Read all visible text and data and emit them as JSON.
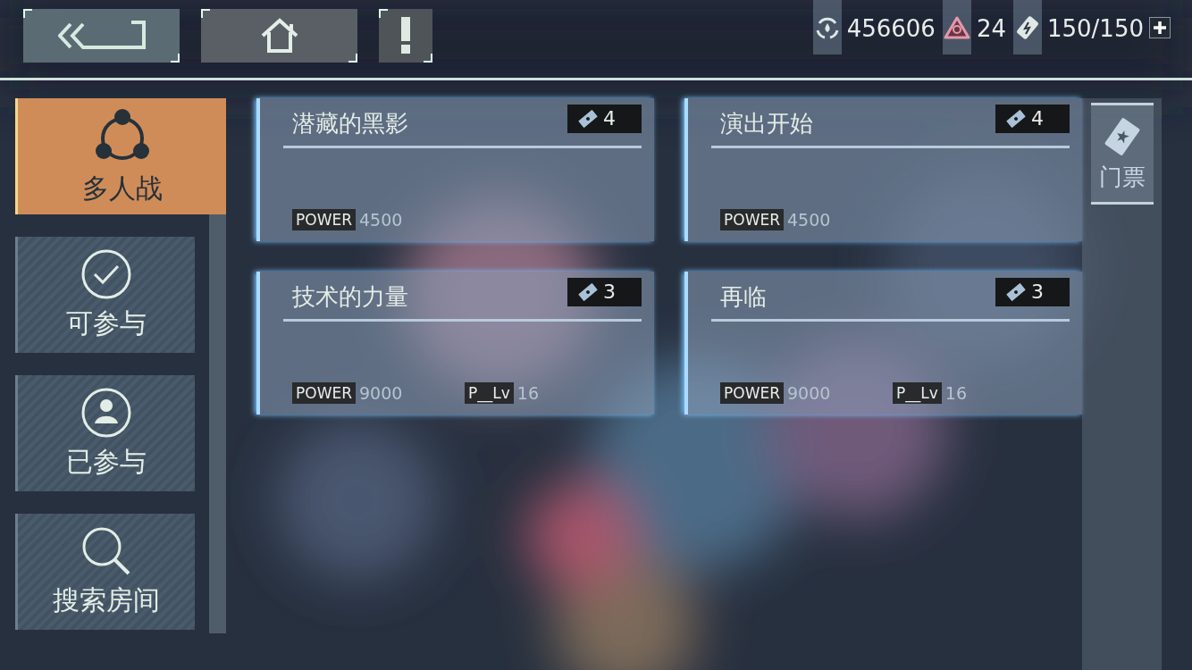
{
  "resources": [
    {
      "kind": "coin",
      "value": "456606",
      "can_add": false
    },
    {
      "kind": "crystal",
      "value": "24",
      "can_add": false
    },
    {
      "kind": "stamina",
      "value": "150/150",
      "can_add": true
    }
  ],
  "sidebar": {
    "items": [
      {
        "kind": "multiplayer",
        "label": "多人战",
        "selected": true
      },
      {
        "kind": "joinable",
        "label": "可参与",
        "selected": false
      },
      {
        "kind": "joined",
        "label": "已参与",
        "selected": false
      },
      {
        "kind": "search",
        "label": "搜索房间",
        "selected": false
      }
    ]
  },
  "cards": [
    {
      "title": "潜藏的黑影",
      "tickets": "4",
      "power_label": "POWER",
      "power": "4500"
    },
    {
      "title": "演出开始",
      "tickets": "4",
      "power_label": "POWER",
      "power": "4500"
    },
    {
      "title": "技术的力量",
      "tickets": "3",
      "power_label": "POWER",
      "power": "9000",
      "level_label": "P__Lv",
      "level": "16"
    },
    {
      "title": "再临",
      "tickets": "3",
      "power_label": "POWER",
      "power": "9000",
      "level_label": "P__Lv",
      "level": "16"
    }
  ],
  "side_tab": {
    "label": "门票"
  }
}
